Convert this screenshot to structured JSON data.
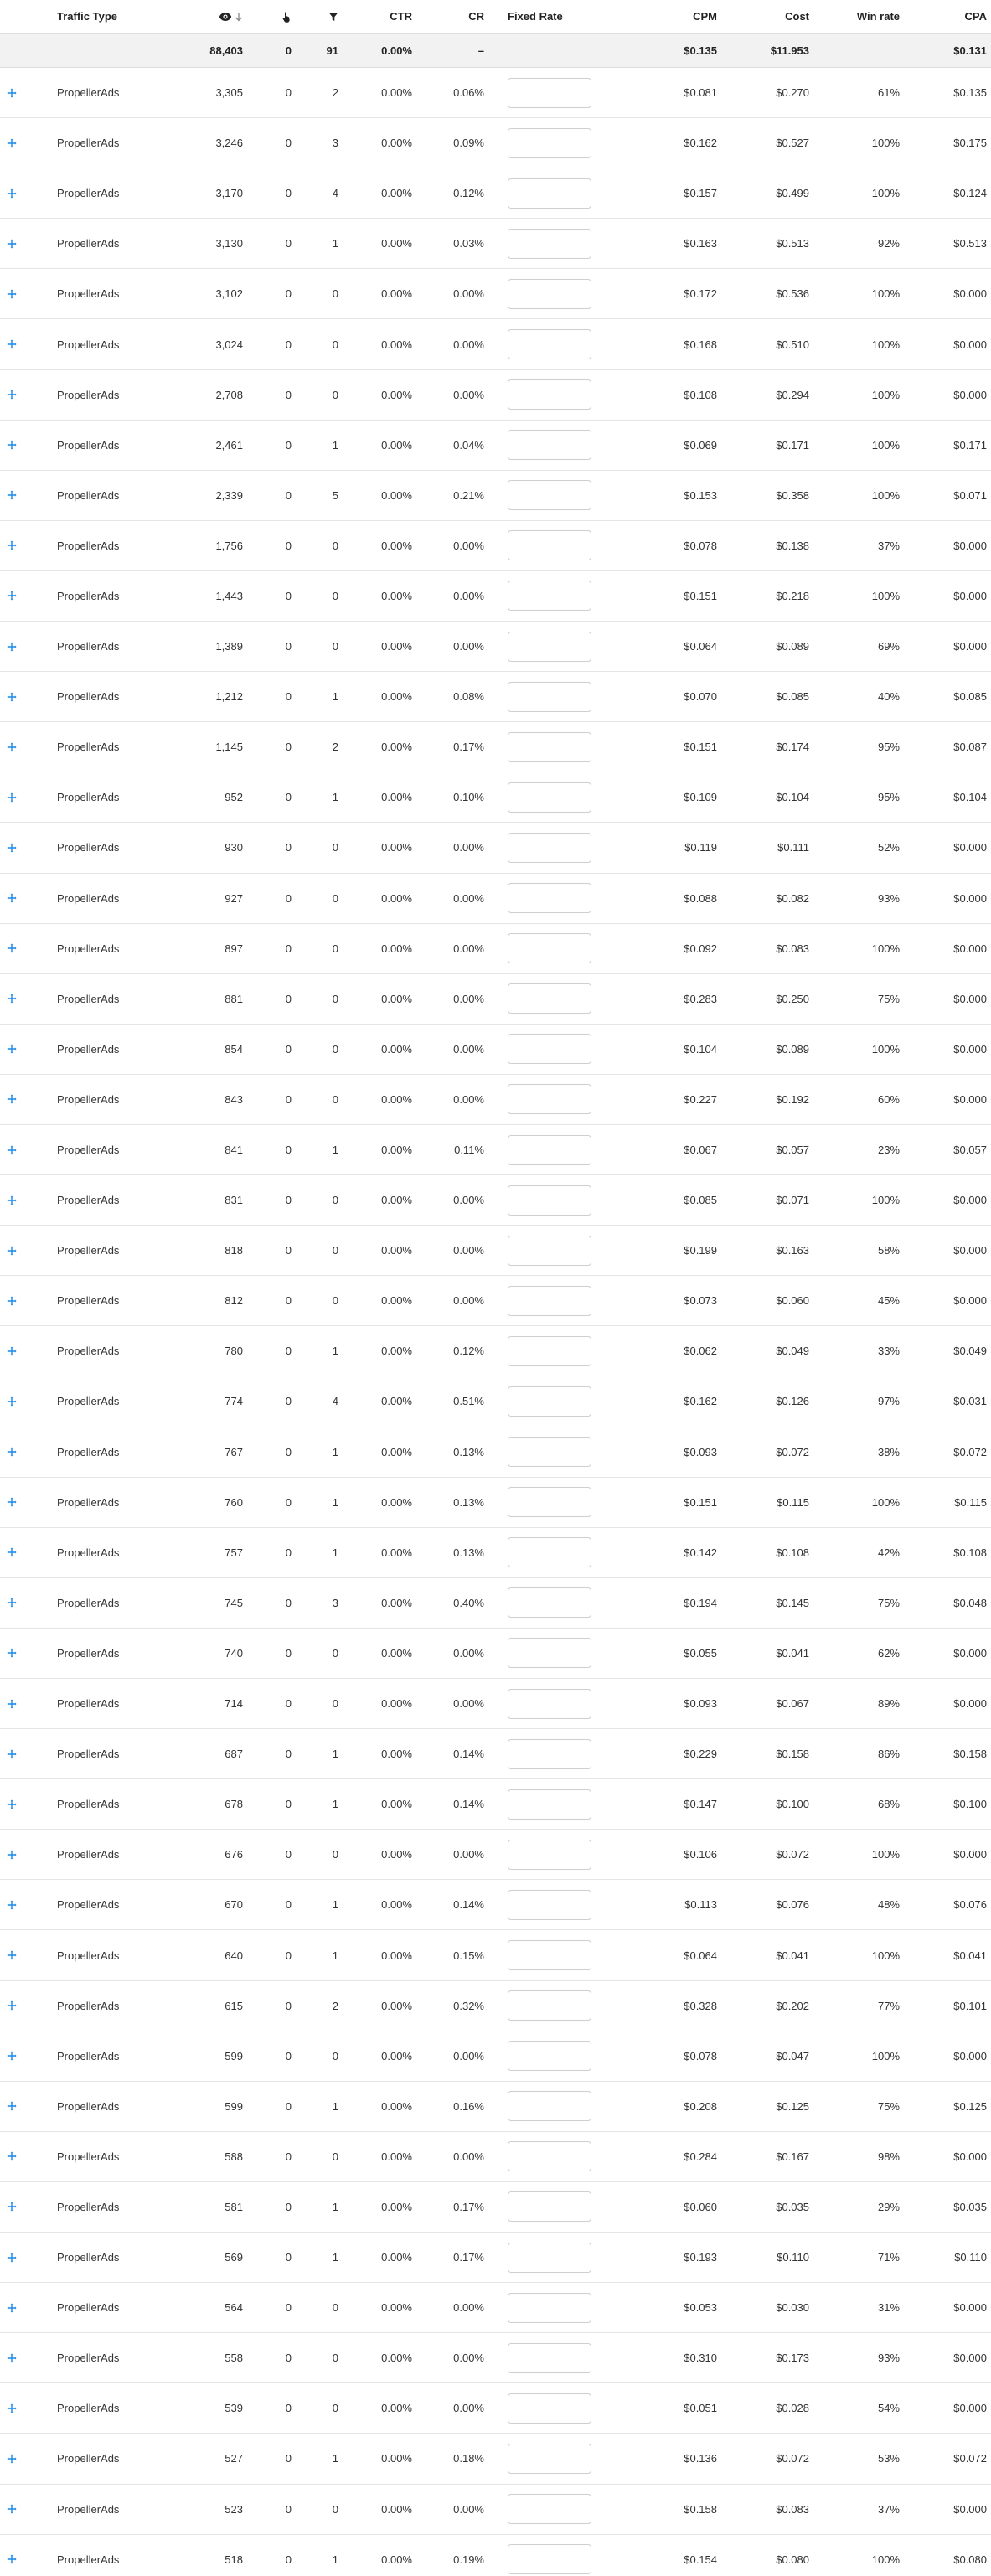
{
  "header": {
    "traffic_type": "Traffic Type",
    "ctr": "CTR",
    "cr": "CR",
    "fixed_rate": "Fixed Rate",
    "cpm": "CPM",
    "cost": "Cost",
    "win_rate": "Win rate",
    "cpa": "CPA",
    "icons": {
      "impressions": "eye-icon",
      "sort": "arrow-down-icon",
      "clicks": "pointer-hand-icon",
      "conversions": "funnel-icon",
      "expand": "expand-icon"
    }
  },
  "summary": {
    "impressions": "88,403",
    "clicks": "0",
    "conversions": "91",
    "ctr": "0.00%",
    "cr": "–",
    "cpm": "$0.135",
    "cost": "$11.953",
    "win_rate": "",
    "cpa": "$0.131"
  },
  "colors": {
    "accent": "#1e88e5",
    "summary_bg": "#f2f2f2",
    "row_border": "#e6e6e6"
  },
  "rows": [
    {
      "type": "PropellerAds",
      "impressions": "3,305",
      "clicks": "0",
      "conversions": "2",
      "ctr": "0.00%",
      "cr": "0.06%",
      "cpm": "$0.081",
      "cost": "$0.270",
      "win_rate": "61%",
      "cpa": "$0.135"
    },
    {
      "type": "PropellerAds",
      "impressions": "3,246",
      "clicks": "0",
      "conversions": "3",
      "ctr": "0.00%",
      "cr": "0.09%",
      "cpm": "$0.162",
      "cost": "$0.527",
      "win_rate": "100%",
      "cpa": "$0.175"
    },
    {
      "type": "PropellerAds",
      "impressions": "3,170",
      "clicks": "0",
      "conversions": "4",
      "ctr": "0.00%",
      "cr": "0.12%",
      "cpm": "$0.157",
      "cost": "$0.499",
      "win_rate": "100%",
      "cpa": "$0.124"
    },
    {
      "type": "PropellerAds",
      "impressions": "3,130",
      "clicks": "0",
      "conversions": "1",
      "ctr": "0.00%",
      "cr": "0.03%",
      "cpm": "$0.163",
      "cost": "$0.513",
      "win_rate": "92%",
      "cpa": "$0.513"
    },
    {
      "type": "PropellerAds",
      "impressions": "3,102",
      "clicks": "0",
      "conversions": "0",
      "ctr": "0.00%",
      "cr": "0.00%",
      "cpm": "$0.172",
      "cost": "$0.536",
      "win_rate": "100%",
      "cpa": "$0.000"
    },
    {
      "type": "PropellerAds",
      "impressions": "3,024",
      "clicks": "0",
      "conversions": "0",
      "ctr": "0.00%",
      "cr": "0.00%",
      "cpm": "$0.168",
      "cost": "$0.510",
      "win_rate": "100%",
      "cpa": "$0.000"
    },
    {
      "type": "PropellerAds",
      "impressions": "2,708",
      "clicks": "0",
      "conversions": "0",
      "ctr": "0.00%",
      "cr": "0.00%",
      "cpm": "$0.108",
      "cost": "$0.294",
      "win_rate": "100%",
      "cpa": "$0.000"
    },
    {
      "type": "PropellerAds",
      "impressions": "2,461",
      "clicks": "0",
      "conversions": "1",
      "ctr": "0.00%",
      "cr": "0.04%",
      "cpm": "$0.069",
      "cost": "$0.171",
      "win_rate": "100%",
      "cpa": "$0.171"
    },
    {
      "type": "PropellerAds",
      "impressions": "2,339",
      "clicks": "0",
      "conversions": "5",
      "ctr": "0.00%",
      "cr": "0.21%",
      "cpm": "$0.153",
      "cost": "$0.358",
      "win_rate": "100%",
      "cpa": "$0.071"
    },
    {
      "type": "PropellerAds",
      "impressions": "1,756",
      "clicks": "0",
      "conversions": "0",
      "ctr": "0.00%",
      "cr": "0.00%",
      "cpm": "$0.078",
      "cost": "$0.138",
      "win_rate": "37%",
      "cpa": "$0.000"
    },
    {
      "type": "PropellerAds",
      "impressions": "1,443",
      "clicks": "0",
      "conversions": "0",
      "ctr": "0.00%",
      "cr": "0.00%",
      "cpm": "$0.151",
      "cost": "$0.218",
      "win_rate": "100%",
      "cpa": "$0.000"
    },
    {
      "type": "PropellerAds",
      "impressions": "1,389",
      "clicks": "0",
      "conversions": "0",
      "ctr": "0.00%",
      "cr": "0.00%",
      "cpm": "$0.064",
      "cost": "$0.089",
      "win_rate": "69%",
      "cpa": "$0.000"
    },
    {
      "type": "PropellerAds",
      "impressions": "1,212",
      "clicks": "0",
      "conversions": "1",
      "ctr": "0.00%",
      "cr": "0.08%",
      "cpm": "$0.070",
      "cost": "$0.085",
      "win_rate": "40%",
      "cpa": "$0.085"
    },
    {
      "type": "PropellerAds",
      "impressions": "1,145",
      "clicks": "0",
      "conversions": "2",
      "ctr": "0.00%",
      "cr": "0.17%",
      "cpm": "$0.151",
      "cost": "$0.174",
      "win_rate": "95%",
      "cpa": "$0.087"
    },
    {
      "type": "PropellerAds",
      "impressions": "952",
      "clicks": "0",
      "conversions": "1",
      "ctr": "0.00%",
      "cr": "0.10%",
      "cpm": "$0.109",
      "cost": "$0.104",
      "win_rate": "95%",
      "cpa": "$0.104"
    },
    {
      "type": "PropellerAds",
      "impressions": "930",
      "clicks": "0",
      "conversions": "0",
      "ctr": "0.00%",
      "cr": "0.00%",
      "cpm": "$0.119",
      "cost": "$0.111",
      "win_rate": "52%",
      "cpa": "$0.000"
    },
    {
      "type": "PropellerAds",
      "impressions": "927",
      "clicks": "0",
      "conversions": "0",
      "ctr": "0.00%",
      "cr": "0.00%",
      "cpm": "$0.088",
      "cost": "$0.082",
      "win_rate": "93%",
      "cpa": "$0.000"
    },
    {
      "type": "PropellerAds",
      "impressions": "897",
      "clicks": "0",
      "conversions": "0",
      "ctr": "0.00%",
      "cr": "0.00%",
      "cpm": "$0.092",
      "cost": "$0.083",
      "win_rate": "100%",
      "cpa": "$0.000"
    },
    {
      "type": "PropellerAds",
      "impressions": "881",
      "clicks": "0",
      "conversions": "0",
      "ctr": "0.00%",
      "cr": "0.00%",
      "cpm": "$0.283",
      "cost": "$0.250",
      "win_rate": "75%",
      "cpa": "$0.000"
    },
    {
      "type": "PropellerAds",
      "impressions": "854",
      "clicks": "0",
      "conversions": "0",
      "ctr": "0.00%",
      "cr": "0.00%",
      "cpm": "$0.104",
      "cost": "$0.089",
      "win_rate": "100%",
      "cpa": "$0.000"
    },
    {
      "type": "PropellerAds",
      "impressions": "843",
      "clicks": "0",
      "conversions": "0",
      "ctr": "0.00%",
      "cr": "0.00%",
      "cpm": "$0.227",
      "cost": "$0.192",
      "win_rate": "60%",
      "cpa": "$0.000"
    },
    {
      "type": "PropellerAds",
      "impressions": "841",
      "clicks": "0",
      "conversions": "1",
      "ctr": "0.00%",
      "cr": "0.11%",
      "cpm": "$0.067",
      "cost": "$0.057",
      "win_rate": "23%",
      "cpa": "$0.057"
    },
    {
      "type": "PropellerAds",
      "impressions": "831",
      "clicks": "0",
      "conversions": "0",
      "ctr": "0.00%",
      "cr": "0.00%",
      "cpm": "$0.085",
      "cost": "$0.071",
      "win_rate": "100%",
      "cpa": "$0.000"
    },
    {
      "type": "PropellerAds",
      "impressions": "818",
      "clicks": "0",
      "conversions": "0",
      "ctr": "0.00%",
      "cr": "0.00%",
      "cpm": "$0.199",
      "cost": "$0.163",
      "win_rate": "58%",
      "cpa": "$0.000"
    },
    {
      "type": "PropellerAds",
      "impressions": "812",
      "clicks": "0",
      "conversions": "0",
      "ctr": "0.00%",
      "cr": "0.00%",
      "cpm": "$0.073",
      "cost": "$0.060",
      "win_rate": "45%",
      "cpa": "$0.000"
    },
    {
      "type": "PropellerAds",
      "impressions": "780",
      "clicks": "0",
      "conversions": "1",
      "ctr": "0.00%",
      "cr": "0.12%",
      "cpm": "$0.062",
      "cost": "$0.049",
      "win_rate": "33%",
      "cpa": "$0.049"
    },
    {
      "type": "PropellerAds",
      "impressions": "774",
      "clicks": "0",
      "conversions": "4",
      "ctr": "0.00%",
      "cr": "0.51%",
      "cpm": "$0.162",
      "cost": "$0.126",
      "win_rate": "97%",
      "cpa": "$0.031"
    },
    {
      "type": "PropellerAds",
      "impressions": "767",
      "clicks": "0",
      "conversions": "1",
      "ctr": "0.00%",
      "cr": "0.13%",
      "cpm": "$0.093",
      "cost": "$0.072",
      "win_rate": "38%",
      "cpa": "$0.072"
    },
    {
      "type": "PropellerAds",
      "impressions": "760",
      "clicks": "0",
      "conversions": "1",
      "ctr": "0.00%",
      "cr": "0.13%",
      "cpm": "$0.151",
      "cost": "$0.115",
      "win_rate": "100%",
      "cpa": "$0.115"
    },
    {
      "type": "PropellerAds",
      "impressions": "757",
      "clicks": "0",
      "conversions": "1",
      "ctr": "0.00%",
      "cr": "0.13%",
      "cpm": "$0.142",
      "cost": "$0.108",
      "win_rate": "42%",
      "cpa": "$0.108"
    },
    {
      "type": "PropellerAds",
      "impressions": "745",
      "clicks": "0",
      "conversions": "3",
      "ctr": "0.00%",
      "cr": "0.40%",
      "cpm": "$0.194",
      "cost": "$0.145",
      "win_rate": "75%",
      "cpa": "$0.048"
    },
    {
      "type": "PropellerAds",
      "impressions": "740",
      "clicks": "0",
      "conversions": "0",
      "ctr": "0.00%",
      "cr": "0.00%",
      "cpm": "$0.055",
      "cost": "$0.041",
      "win_rate": "62%",
      "cpa": "$0.000"
    },
    {
      "type": "PropellerAds",
      "impressions": "714",
      "clicks": "0",
      "conversions": "0",
      "ctr": "0.00%",
      "cr": "0.00%",
      "cpm": "$0.093",
      "cost": "$0.067",
      "win_rate": "89%",
      "cpa": "$0.000"
    },
    {
      "type": "PropellerAds",
      "impressions": "687",
      "clicks": "0",
      "conversions": "1",
      "ctr": "0.00%",
      "cr": "0.14%",
      "cpm": "$0.229",
      "cost": "$0.158",
      "win_rate": "86%",
      "cpa": "$0.158"
    },
    {
      "type": "PropellerAds",
      "impressions": "678",
      "clicks": "0",
      "conversions": "1",
      "ctr": "0.00%",
      "cr": "0.14%",
      "cpm": "$0.147",
      "cost": "$0.100",
      "win_rate": "68%",
      "cpa": "$0.100"
    },
    {
      "type": "PropellerAds",
      "impressions": "676",
      "clicks": "0",
      "conversions": "0",
      "ctr": "0.00%",
      "cr": "0.00%",
      "cpm": "$0.106",
      "cost": "$0.072",
      "win_rate": "100%",
      "cpa": "$0.000"
    },
    {
      "type": "PropellerAds",
      "impressions": "670",
      "clicks": "0",
      "conversions": "1",
      "ctr": "0.00%",
      "cr": "0.14%",
      "cpm": "$0.113",
      "cost": "$0.076",
      "win_rate": "48%",
      "cpa": "$0.076"
    },
    {
      "type": "PropellerAds",
      "impressions": "640",
      "clicks": "0",
      "conversions": "1",
      "ctr": "0.00%",
      "cr": "0.15%",
      "cpm": "$0.064",
      "cost": "$0.041",
      "win_rate": "100%",
      "cpa": "$0.041"
    },
    {
      "type": "PropellerAds",
      "impressions": "615",
      "clicks": "0",
      "conversions": "2",
      "ctr": "0.00%",
      "cr": "0.32%",
      "cpm": "$0.328",
      "cost": "$0.202",
      "win_rate": "77%",
      "cpa": "$0.101"
    },
    {
      "type": "PropellerAds",
      "impressions": "599",
      "clicks": "0",
      "conversions": "0",
      "ctr": "0.00%",
      "cr": "0.00%",
      "cpm": "$0.078",
      "cost": "$0.047",
      "win_rate": "100%",
      "cpa": "$0.000"
    },
    {
      "type": "PropellerAds",
      "impressions": "599",
      "clicks": "0",
      "conversions": "1",
      "ctr": "0.00%",
      "cr": "0.16%",
      "cpm": "$0.208",
      "cost": "$0.125",
      "win_rate": "75%",
      "cpa": "$0.125"
    },
    {
      "type": "PropellerAds",
      "impressions": "588",
      "clicks": "0",
      "conversions": "0",
      "ctr": "0.00%",
      "cr": "0.00%",
      "cpm": "$0.284",
      "cost": "$0.167",
      "win_rate": "98%",
      "cpa": "$0.000"
    },
    {
      "type": "PropellerAds",
      "impressions": "581",
      "clicks": "0",
      "conversions": "1",
      "ctr": "0.00%",
      "cr": "0.17%",
      "cpm": "$0.060",
      "cost": "$0.035",
      "win_rate": "29%",
      "cpa": "$0.035"
    },
    {
      "type": "PropellerAds",
      "impressions": "569",
      "clicks": "0",
      "conversions": "1",
      "ctr": "0.00%",
      "cr": "0.17%",
      "cpm": "$0.193",
      "cost": "$0.110",
      "win_rate": "71%",
      "cpa": "$0.110"
    },
    {
      "type": "PropellerAds",
      "impressions": "564",
      "clicks": "0",
      "conversions": "0",
      "ctr": "0.00%",
      "cr": "0.00%",
      "cpm": "$0.053",
      "cost": "$0.030",
      "win_rate": "31%",
      "cpa": "$0.000"
    },
    {
      "type": "PropellerAds",
      "impressions": "558",
      "clicks": "0",
      "conversions": "0",
      "ctr": "0.00%",
      "cr": "0.00%",
      "cpm": "$0.310",
      "cost": "$0.173",
      "win_rate": "93%",
      "cpa": "$0.000"
    },
    {
      "type": "PropellerAds",
      "impressions": "539",
      "clicks": "0",
      "conversions": "0",
      "ctr": "0.00%",
      "cr": "0.00%",
      "cpm": "$0.051",
      "cost": "$0.028",
      "win_rate": "54%",
      "cpa": "$0.000"
    },
    {
      "type": "PropellerAds",
      "impressions": "527",
      "clicks": "0",
      "conversions": "1",
      "ctr": "0.00%",
      "cr": "0.18%",
      "cpm": "$0.136",
      "cost": "$0.072",
      "win_rate": "53%",
      "cpa": "$0.072"
    },
    {
      "type": "PropellerAds",
      "impressions": "523",
      "clicks": "0",
      "conversions": "0",
      "ctr": "0.00%",
      "cr": "0.00%",
      "cpm": "$0.158",
      "cost": "$0.083",
      "win_rate": "37%",
      "cpa": "$0.000"
    },
    {
      "type": "PropellerAds",
      "impressions": "518",
      "clicks": "0",
      "conversions": "1",
      "ctr": "0.00%",
      "cr": "0.19%",
      "cpm": "$0.154",
      "cost": "$0.080",
      "win_rate": "100%",
      "cpa": "$0.080"
    }
  ]
}
